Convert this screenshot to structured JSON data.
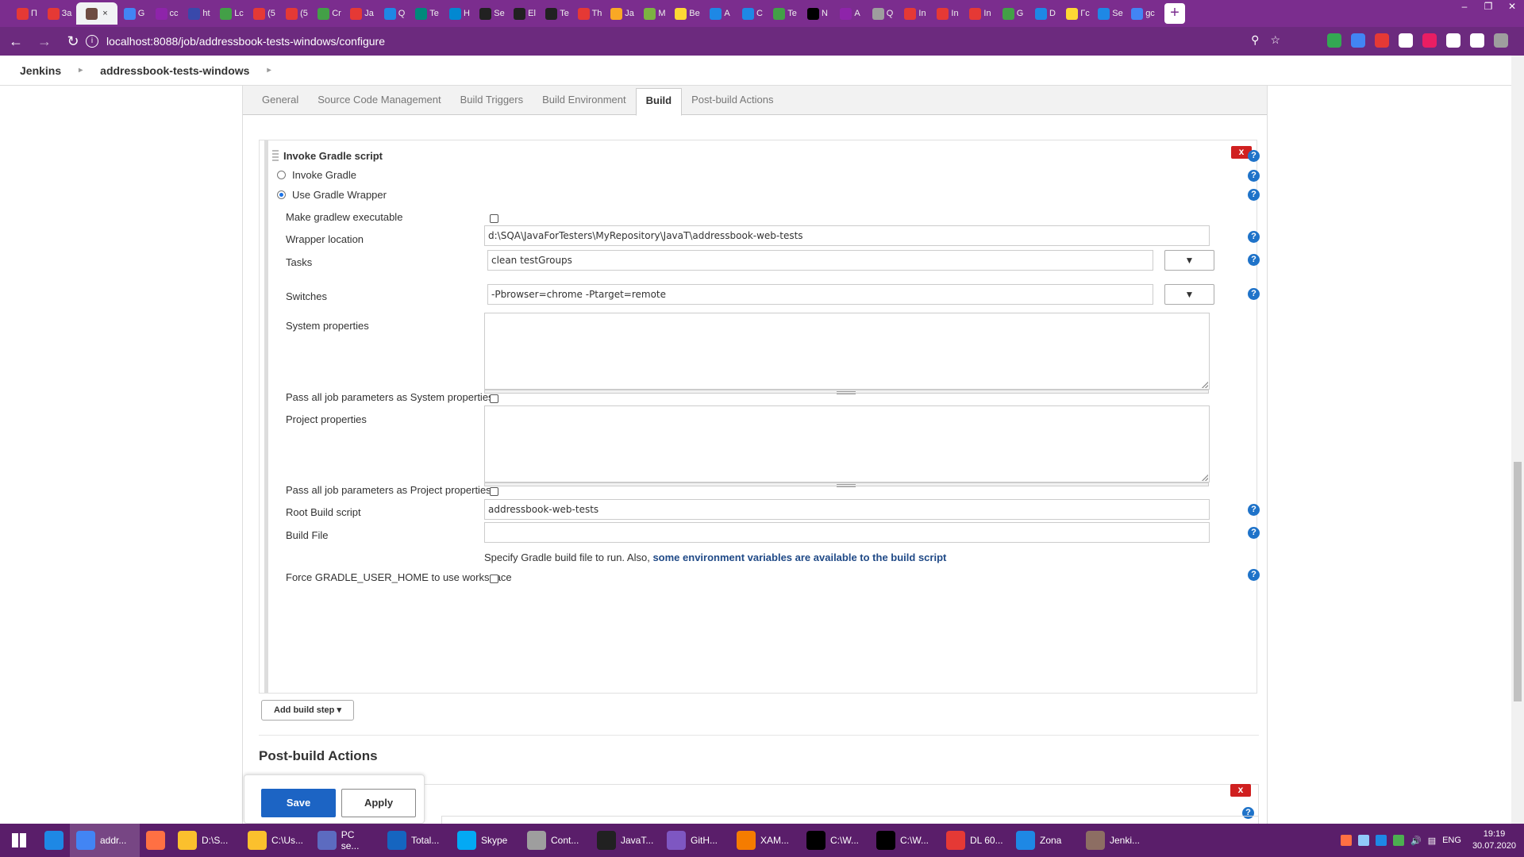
{
  "browser": {
    "tabs": [
      {
        "label": "П",
        "color": "#e53935"
      },
      {
        "label": "За",
        "color": "#e53935"
      },
      {
        "label": "",
        "color": "#6d4c41",
        "active": true
      },
      {
        "label": "G",
        "color": "#4285f4"
      },
      {
        "label": "cc",
        "color": "#8e24aa"
      },
      {
        "label": "ht",
        "color": "#3949ab"
      },
      {
        "label": "Lc",
        "color": "#43a047"
      },
      {
        "label": "(5",
        "color": "#e53935"
      },
      {
        "label": "(5",
        "color": "#e53935"
      },
      {
        "label": "Cr",
        "color": "#43a047"
      },
      {
        "label": "Ja",
        "color": "#e53935"
      },
      {
        "label": "Q",
        "color": "#1e88e5"
      },
      {
        "label": "Te",
        "color": "#00897b"
      },
      {
        "label": "H",
        "color": "#0288d1"
      },
      {
        "label": "Se",
        "color": "#212121"
      },
      {
        "label": "El",
        "color": "#212121"
      },
      {
        "label": "Te",
        "color": "#212121"
      },
      {
        "label": "Th",
        "color": "#e53935"
      },
      {
        "label": "Ja",
        "color": "#f9a825"
      },
      {
        "label": "M",
        "color": "#7cb342"
      },
      {
        "label": "Be",
        "color": "#fdd835"
      },
      {
        "label": "A",
        "color": "#1e88e5"
      },
      {
        "label": "C",
        "color": "#1e88e5"
      },
      {
        "label": "Te",
        "color": "#43a047"
      },
      {
        "label": "N",
        "color": "#000000"
      },
      {
        "label": "A",
        "color": "#8e24aa"
      },
      {
        "label": "Q",
        "color": "#9e9e9e"
      },
      {
        "label": "In",
        "color": "#e53935"
      },
      {
        "label": "In",
        "color": "#e53935"
      },
      {
        "label": "In",
        "color": "#e53935"
      },
      {
        "label": "G",
        "color": "#43a047"
      },
      {
        "label": "D",
        "color": "#1e88e5"
      },
      {
        "label": "Гс",
        "color": "#fdd835"
      },
      {
        "label": "Se",
        "color": "#1e88e5"
      },
      {
        "label": "gc",
        "color": "#4285f4"
      }
    ],
    "new_tab": "+",
    "url": "localhost:8088/job/addressbook-tests-windows/configure",
    "ext_colors": [
      "#34a853",
      "#4285f4",
      "#e53935",
      "#ffffff",
      "#e91e63",
      "#ffffff",
      "#ffffff",
      "#9e9e9e"
    ]
  },
  "breadcrumb": {
    "root": "Jenkins",
    "job": "addressbook-tests-windows"
  },
  "config_tabs": [
    {
      "label": "General"
    },
    {
      "label": "Source Code Management"
    },
    {
      "label": "Build Triggers"
    },
    {
      "label": "Build Environment"
    },
    {
      "label": "Build",
      "active": true
    },
    {
      "label": "Post-build Actions"
    }
  ],
  "build": {
    "section_title": "Build",
    "step_title": "Invoke Gradle script",
    "delete_label": "x",
    "help_glyph": "?",
    "radio_invoke": "Invoke Gradle",
    "radio_wrapper": "Use Gradle Wrapper",
    "make_executable_label": "Make gradlew executable",
    "wrapper_location_label": "Wrapper location",
    "wrapper_location_value": "d:\\SQA\\JavaForTesters\\MyRepository\\JavaT\\addressbook-web-tests",
    "tasks_label": "Tasks",
    "tasks_value": "clean testGroups",
    "switches_label": "Switches",
    "switches_value": "-Pbrowser=chrome -Ptarget=remote",
    "dropdown_glyph": "▼",
    "system_props_label": "System properties",
    "pass_system_label": "Pass all job parameters as System properties",
    "project_props_label": "Project properties",
    "pass_project_label": "Pass all job parameters as Project properties",
    "root_script_label": "Root Build script",
    "root_script_value": "addressbook-web-tests",
    "build_file_label": "Build File",
    "build_file_value": "",
    "note_text": "Specify Gradle build file to run. Also, ",
    "note_link": "some environment variables are available to the build script",
    "force_home_label": "Force GRADLE_USER_HOME to use workspace",
    "add_step_label": "Add build step ▾"
  },
  "post_build": {
    "title": "Post-build Actions"
  },
  "actions": {
    "save": "Save",
    "apply": "Apply"
  },
  "taskbar": {
    "items": [
      {
        "label": "",
        "color": "#1e88e5"
      },
      {
        "label": "addr...",
        "color": "#4285f4",
        "active": true
      },
      {
        "label": "",
        "color": "#ff7043"
      },
      {
        "label": "D:\\S...",
        "color": "#fbc02d"
      },
      {
        "label": "C:\\Us...",
        "color": "#fbc02d"
      },
      {
        "label": "PC se...",
        "color": "#5c6bc0"
      },
      {
        "label": "Total...",
        "color": "#1565c0"
      },
      {
        "label": "Skype",
        "color": "#03a9f4"
      },
      {
        "label": "Cont...",
        "color": "#9e9e9e"
      },
      {
        "label": "JavaT...",
        "color": "#212121"
      },
      {
        "label": "GitH...",
        "color": "#7e57c2"
      },
      {
        "label": "XAM...",
        "color": "#f57c00"
      },
      {
        "label": "C:\\W...",
        "color": "#000000"
      },
      {
        "label": "C:\\W...",
        "color": "#000000"
      },
      {
        "label": "DL 60...",
        "color": "#e53935"
      },
      {
        "label": "Zona",
        "color": "#1e88e5"
      },
      {
        "label": "Jenki...",
        "color": "#8d6e63"
      }
    ],
    "lang": "ENG",
    "time": "19:19",
    "date": "30.07.2020"
  }
}
